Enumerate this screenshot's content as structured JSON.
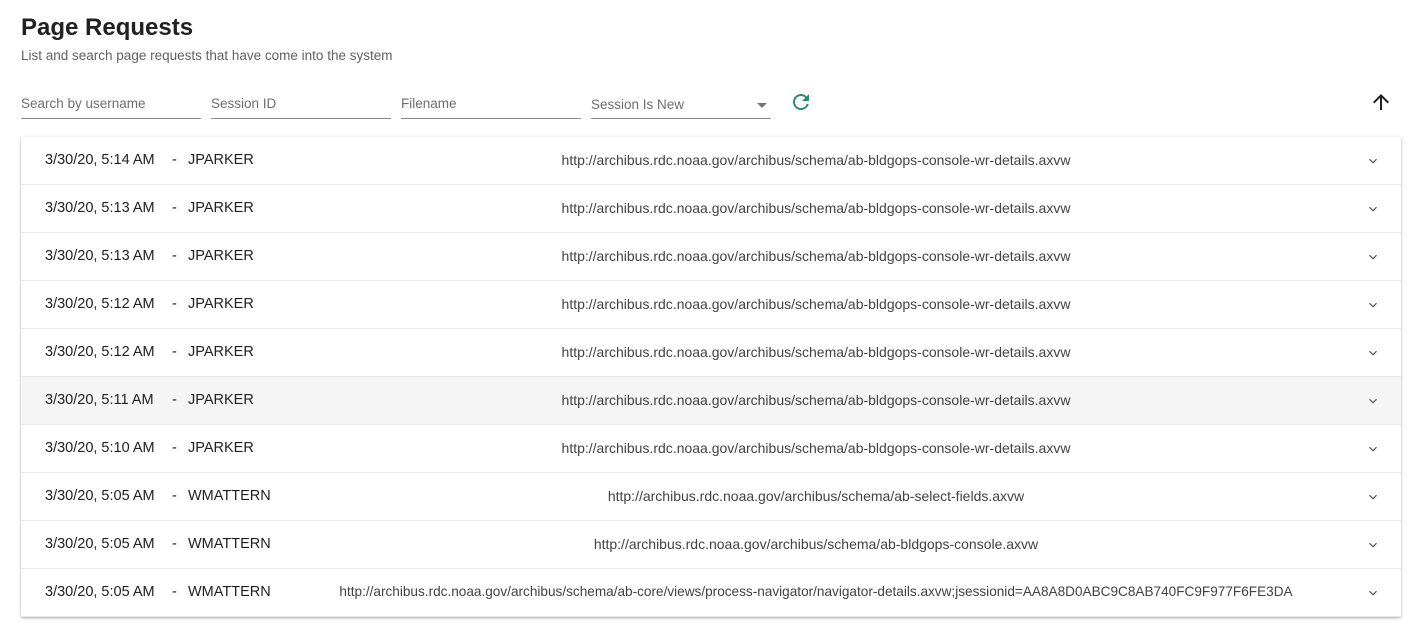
{
  "header": {
    "title": "Page Requests",
    "subtitle": "List and search page requests that have come into the system"
  },
  "filters": {
    "username_placeholder": "Search by username",
    "session_id_placeholder": "Session ID",
    "filename_placeholder": "Filename",
    "session_is_new_label": "Session Is New",
    "refresh_icon": "refresh-icon",
    "sort_icon": "arrow-up-icon",
    "accent_color": "#2e8b6f"
  },
  "rows": [
    {
      "date": "3/30/20, 5:14 AM",
      "sep": "-",
      "user": "JPARKER",
      "url": "http://archibus.rdc.noaa.gov/archibus/schema/ab-bldgops-console-wr-details.axvw"
    },
    {
      "date": "3/30/20, 5:13 AM",
      "sep": "-",
      "user": "JPARKER",
      "url": "http://archibus.rdc.noaa.gov/archibus/schema/ab-bldgops-console-wr-details.axvw"
    },
    {
      "date": "3/30/20, 5:13 AM",
      "sep": "-",
      "user": "JPARKER",
      "url": "http://archibus.rdc.noaa.gov/archibus/schema/ab-bldgops-console-wr-details.axvw"
    },
    {
      "date": "3/30/20, 5:12 AM",
      "sep": "-",
      "user": "JPARKER",
      "url": "http://archibus.rdc.noaa.gov/archibus/schema/ab-bldgops-console-wr-details.axvw"
    },
    {
      "date": "3/30/20, 5:12 AM",
      "sep": "-",
      "user": "JPARKER",
      "url": "http://archibus.rdc.noaa.gov/archibus/schema/ab-bldgops-console-wr-details.axvw"
    },
    {
      "date": "3/30/20, 5:11 AM",
      "sep": "-",
      "user": "JPARKER",
      "url": "http://archibus.rdc.noaa.gov/archibus/schema/ab-bldgops-console-wr-details.axvw"
    },
    {
      "date": "3/30/20, 5:10 AM",
      "sep": "-",
      "user": "JPARKER",
      "url": "http://archibus.rdc.noaa.gov/archibus/schema/ab-bldgops-console-wr-details.axvw"
    },
    {
      "date": "3/30/20, 5:05 AM",
      "sep": "-",
      "user": "WMATTERN",
      "url": "http://archibus.rdc.noaa.gov/archibus/schema/ab-select-fields.axvw"
    },
    {
      "date": "3/30/20, 5:05 AM",
      "sep": "-",
      "user": "WMATTERN",
      "url": "http://archibus.rdc.noaa.gov/archibus/schema/ab-bldgops-console.axvw"
    },
    {
      "date": "3/30/20, 5:05 AM",
      "sep": "-",
      "user": "WMATTERN",
      "url": "http://archibus.rdc.noaa.gov/archibus/schema/ab-core/views/process-navigator/navigator-details.axvw;jsessionid=AA8A8D0ABC9C8AB740FC9F977F6FE3DA"
    }
  ]
}
